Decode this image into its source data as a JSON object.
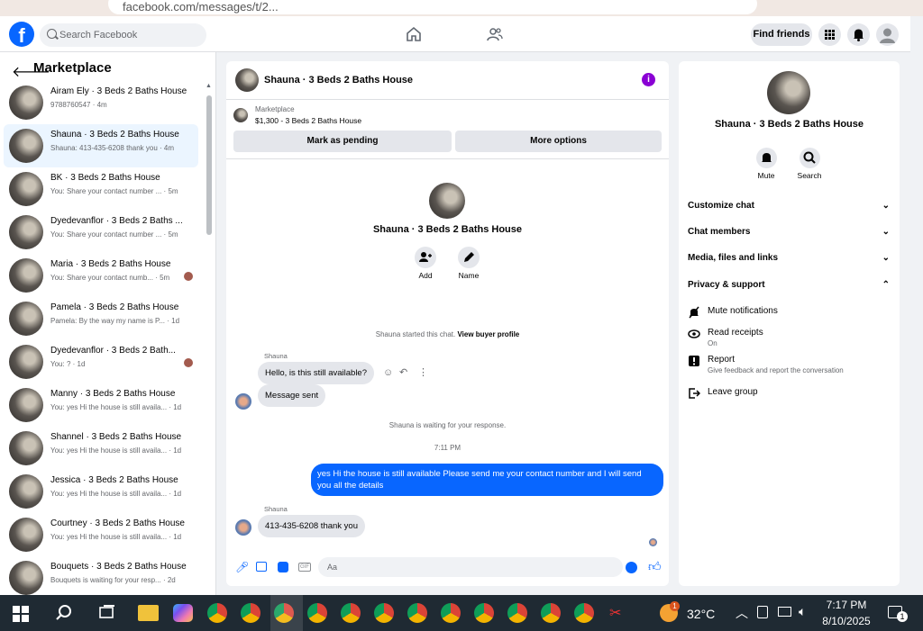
{
  "browser": {
    "url_fragment": "facebook.com/messages/t/2..."
  },
  "header": {
    "logo": "f",
    "search_placeholder": "Search Facebook",
    "find_friends": "Find friends"
  },
  "sidebar": {
    "title": "Marketplace",
    "conversations": [
      {
        "name": "Airam Ely · 3 Beds 2 Baths House",
        "preview": "9788760547 · 4m"
      },
      {
        "name": "Shauna · 3 Beds 2 Baths House",
        "preview": "Shauna: 413-435-6208 thank you · 4m"
      },
      {
        "name": "BK · 3 Beds 2 Baths House",
        "preview": "You: Share your contact number ... · 5m"
      },
      {
        "name": "Dyedevanflor · 3 Beds 2 Baths ...",
        "preview": "You: Share your contact number ... · 5m"
      },
      {
        "name": "Maria · 3 Beds 2 Baths House",
        "preview": "You: Share your contact numb... · 5m"
      },
      {
        "name": "Pamela · 3 Beds 2 Baths House",
        "preview": "Pamela: By the way my name is P... · 1d"
      },
      {
        "name": "Dyedevanflor · 3 Beds 2 Bath...",
        "preview": "You: ? · 1d"
      },
      {
        "name": "Manny · 3 Beds 2 Baths House",
        "preview": "You: yes Hi the house is still availa... · 1d"
      },
      {
        "name": "Shannel · 3 Beds 2 Baths House",
        "preview": "You: yes Hi the house is still availa... · 1d"
      },
      {
        "name": "Jessica · 3 Beds 2 Baths House",
        "preview": "You: yes Hi the house is still availa... · 1d"
      },
      {
        "name": "Courtney · 3 Beds 2 Baths House",
        "preview": "You: yes Hi the house is still availa... · 1d"
      },
      {
        "name": "Bouquets · 3 Beds 2 Baths House",
        "preview": "Bouquets is waiting for your resp... · 2d"
      }
    ]
  },
  "chat": {
    "title": "Shauna · 3 Beds 2 Baths House",
    "listing_label": "Marketplace",
    "listing_price": "$1,300 - 3 Beds 2 Baths House",
    "mark_pending": "Mark as pending",
    "more_options": "More options",
    "profile_name": "Shauna · 3 Beds 2 Baths House",
    "add_label": "Add",
    "name_label": "Name",
    "started_text": "Shauna started this chat.",
    "view_profile": "View buyer profile",
    "sender1": "Shauna",
    "msg1": "Hello, is this still available?",
    "msg_sent": "Message sent",
    "waiting": "Shauna is waiting for your response.",
    "time": "7:11 PM",
    "my_msg_line1": "yes Hi the house is still available Please send me your contact number and I will send",
    "my_msg_line2": "you all the details",
    "sender2": "Shauna",
    "msg2": "413-435-6208 thank you",
    "composer_placeholder": "Aa"
  },
  "info": {
    "name": "Shauna · 3 Beds 2 Baths House",
    "mute": "Mute",
    "search": "Search",
    "customize": "Customize chat",
    "members": "Chat members",
    "media": "Media, files and links",
    "privacy": "Privacy & support",
    "mute_notif": "Mute notifications",
    "read_receipts": "Read receipts",
    "read_receipts_state": "On",
    "report": "Report",
    "report_sub": "Give feedback and report the conversation",
    "leave": "Leave group"
  },
  "taskbar": {
    "temp": "32°C",
    "time": "7:17 PM",
    "date": "8/10/2025",
    "notif_count": "1",
    "weather_badge": "1"
  }
}
